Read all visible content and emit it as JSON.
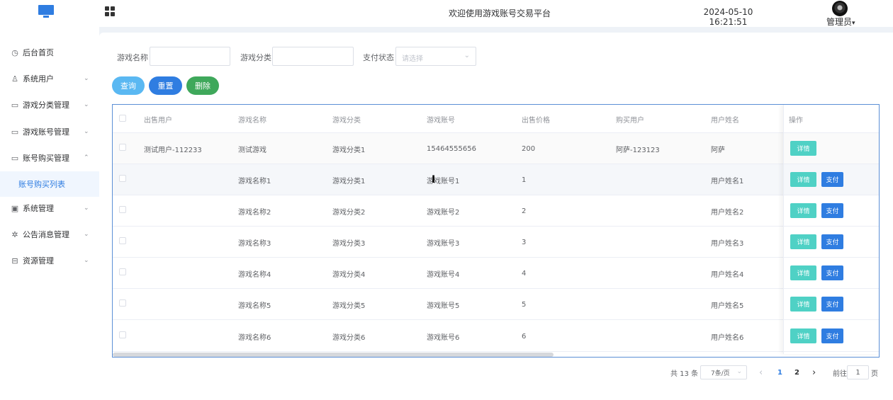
{
  "header": {
    "logo_icon": "monitor-icon",
    "menu_toggle_icon": "grid-icon",
    "title": "欢迎使用游戏账号交易平台",
    "datetime": "2024-05-10 16:21:51",
    "user_label": "管理员",
    "user_chevron": "▾"
  },
  "sidebar": {
    "items": [
      {
        "label": "后台首页",
        "icon": "clock-icon",
        "glyph": "◷",
        "chevron": ""
      },
      {
        "label": "系统用户",
        "icon": "user-icon",
        "glyph": "♙",
        "chevron": "⌄"
      },
      {
        "label": "游戏分类管理",
        "icon": "card-icon",
        "glyph": "▭",
        "chevron": "⌄"
      },
      {
        "label": "游戏账号管理",
        "icon": "card-icon",
        "glyph": "▭",
        "chevron": "⌄"
      },
      {
        "label": "账号购买管理",
        "icon": "card-icon",
        "glyph": "▭",
        "chevron": "⌃"
      },
      {
        "label": "系统管理",
        "icon": "folder-icon",
        "glyph": "▣",
        "chevron": "⌄"
      },
      {
        "label": "公告消息管理",
        "icon": "sun-icon",
        "glyph": "✲",
        "chevron": "⌄"
      },
      {
        "label": "资源管理",
        "icon": "box-icon",
        "glyph": "⊟",
        "chevron": "⌄"
      }
    ],
    "active_subitem": "账号购买列表"
  },
  "filters": {
    "game_name_label": "游戏名称",
    "game_name_value": "",
    "category_label": "游戏分类",
    "category_value": "",
    "pay_status_label": "支付状态",
    "pay_status_placeholder": "请选择"
  },
  "actions": {
    "query": "查询",
    "reset": "重置",
    "delete": "删除"
  },
  "colors": {
    "query_button": "#5ab8f2",
    "reset_button": "#2f7de1",
    "delete_button": "#3fa85b",
    "detail_button": "#4fd1c5",
    "pay_button": "#2f7de1",
    "accent": "#2f7de1"
  },
  "table": {
    "columns": [
      "出售用户",
      "游戏名称",
      "游戏分类",
      "游戏账号",
      "出售价格",
      "购买用户",
      "用户姓名",
      "操作"
    ],
    "detail_label": "详情",
    "pay_label": "支付",
    "rows": [
      {
        "seller": "测试用户-112233",
        "name": "测试游戏",
        "category": "游戏分类1",
        "account": "15464555656",
        "price": "200",
        "buyer": "阿萨-123123",
        "username": "阿萨",
        "show_pay": false
      },
      {
        "seller": "",
        "name": "游戏名称1",
        "category": "游戏分类1",
        "account": "游戏账号1",
        "price": "1",
        "buyer": "",
        "username": "用户姓名1",
        "show_pay": true
      },
      {
        "seller": "",
        "name": "游戏名称2",
        "category": "游戏分类2",
        "account": "游戏账号2",
        "price": "2",
        "buyer": "",
        "username": "用户姓名2",
        "show_pay": true
      },
      {
        "seller": "",
        "name": "游戏名称3",
        "category": "游戏分类3",
        "account": "游戏账号3",
        "price": "3",
        "buyer": "",
        "username": "用户姓名3",
        "show_pay": true
      },
      {
        "seller": "",
        "name": "游戏名称4",
        "category": "游戏分类4",
        "account": "游戏账号4",
        "price": "4",
        "buyer": "",
        "username": "用户姓名4",
        "show_pay": true
      },
      {
        "seller": "",
        "name": "游戏名称5",
        "category": "游戏分类5",
        "account": "游戏账号5",
        "price": "5",
        "buyer": "",
        "username": "用户姓名5",
        "show_pay": true
      },
      {
        "seller": "",
        "name": "游戏名称6",
        "category": "游戏分类6",
        "account": "游戏账号6",
        "price": "6",
        "buyer": "",
        "username": "用户姓名6",
        "show_pay": true
      }
    ]
  },
  "pagination": {
    "total": "共 13 条",
    "page_size": "7条/页",
    "page_size_chevron": "⌄",
    "prev": "‹",
    "pages": [
      "1",
      "2"
    ],
    "current_page": "1",
    "next": "›",
    "goto_label": "前往",
    "goto_value": "1",
    "goto_suffix": "页"
  }
}
